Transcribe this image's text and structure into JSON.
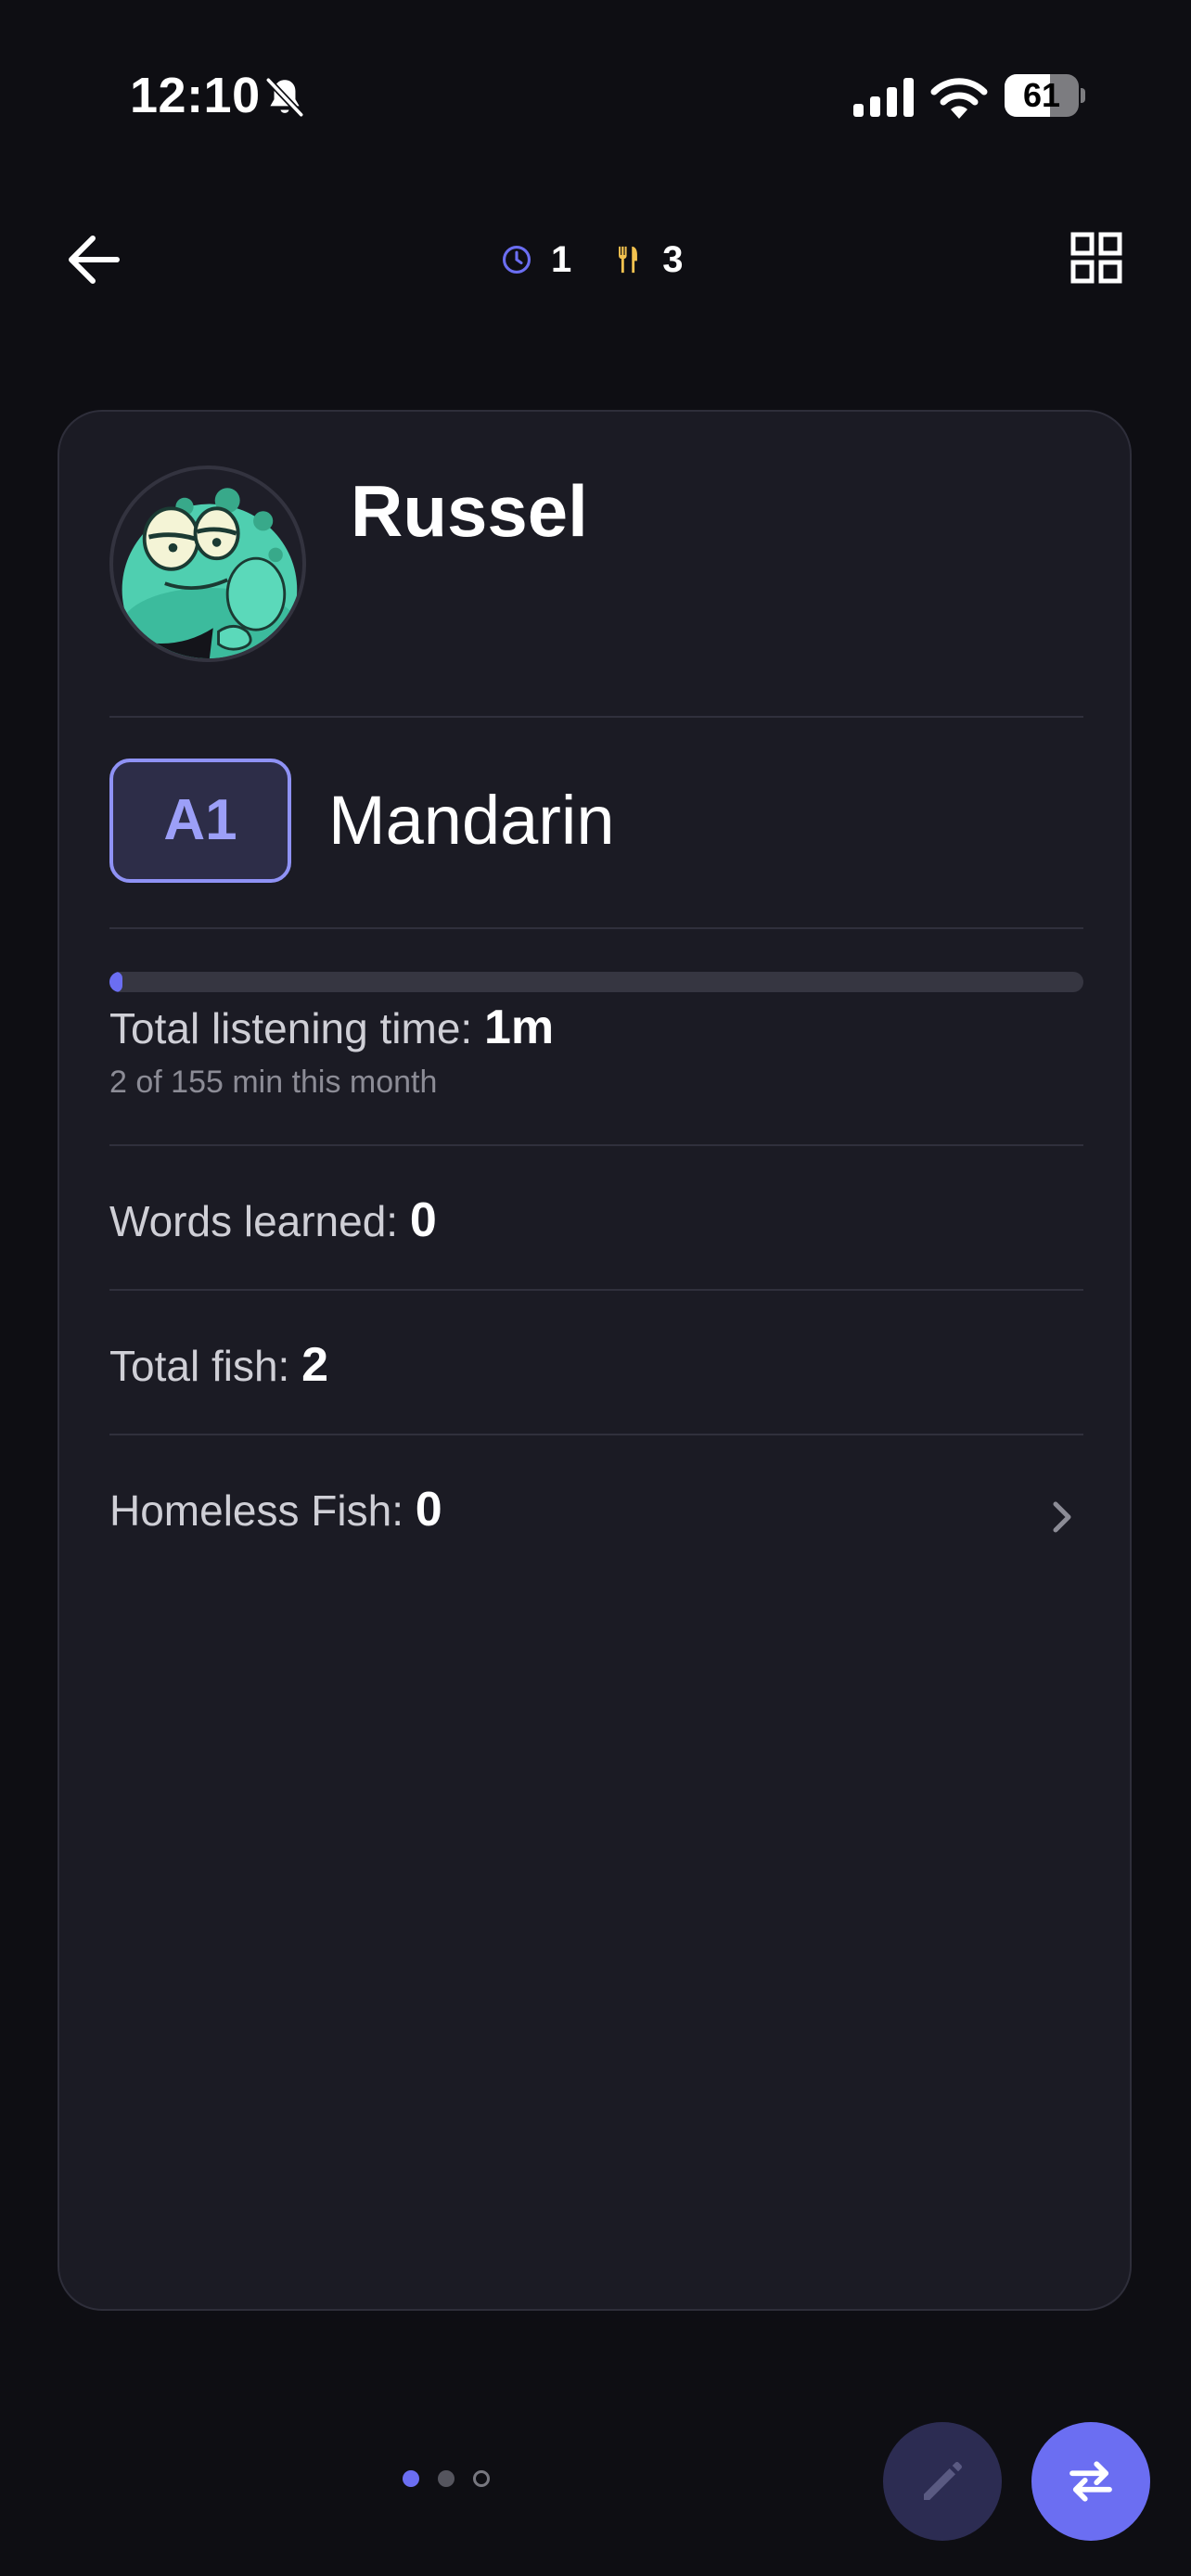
{
  "status_bar": {
    "time": "12:10",
    "battery_level": "61",
    "battery_fraction": 0.61,
    "icons": [
      "bell-slash-icon",
      "cellular-signal-icon",
      "wifi-icon",
      "battery-icon"
    ]
  },
  "header": {
    "back_icon": "arrow-left-icon",
    "clock_count": "1",
    "food_count": "3",
    "clock_icon_color": "#6b6ef2",
    "food_icon_color": "#f3c24f",
    "grid_icon": "grid-icon"
  },
  "profile": {
    "name": "Russel",
    "avatar_icon": "frog-avatar",
    "level": "A1",
    "language": "Mandarin"
  },
  "stats": {
    "listening_label": "Total listening time:",
    "listening_value": "1m",
    "listening_progress": 0.013,
    "listening_subtext": "2 of 155 min this month",
    "words_label": "Words learned:",
    "words_value": "0",
    "fish_label": "Total fish:",
    "fish_value": "2",
    "homeless_label": "Homeless Fish:",
    "homeless_value": "0"
  },
  "pager": {
    "pages": 3,
    "current": 1
  },
  "actions": {
    "edit_icon": "pencil-icon",
    "swap_icon": "swap-arrows-icon"
  },
  "colors": {
    "accent": "#6b6ef2",
    "background": "#0e0e13",
    "card": "#1b1b24",
    "badge_border": "#8f92f5"
  }
}
